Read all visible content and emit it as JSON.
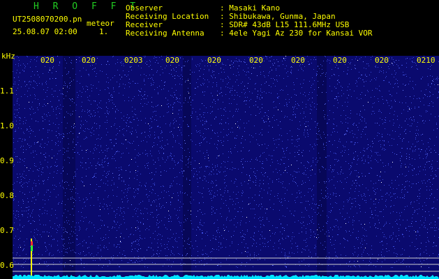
{
  "header": {
    "program": "H R O F F T",
    "filename": "UT2508070200.pn",
    "mode": "meteor",
    "timestamp": "25.08.07 02:00",
    "count": "1.",
    "labels": [
      "Observer",
      "Receiving Location",
      "Receiver",
      "Receiving Antenna"
    ],
    "values": [
      ": Masaki Kano",
      ": Shibukawa, Gunma, Japan",
      ": SDR# 43dB L15 111.6MHz USB",
      ": 4ele Yagi Az 230 for Kansai VOR"
    ]
  },
  "yaxis": {
    "unit": "kHz",
    "ticks": [
      "1.1",
      "1.0",
      "0.9",
      "0.8",
      "0.7",
      "0.6"
    ]
  },
  "xaxis": {
    "ticks": [
      "020",
      "020",
      "0203",
      "020",
      "020",
      "020",
      "020",
      "020",
      "020",
      "0210"
    ]
  },
  "colors": {
    "background": "#0a0a6e",
    "noise": "#3b4bdc",
    "baseline": "#00e5ff",
    "guides": "#d0d0d0",
    "text": "#ffff00",
    "title": "#22cc22"
  }
}
